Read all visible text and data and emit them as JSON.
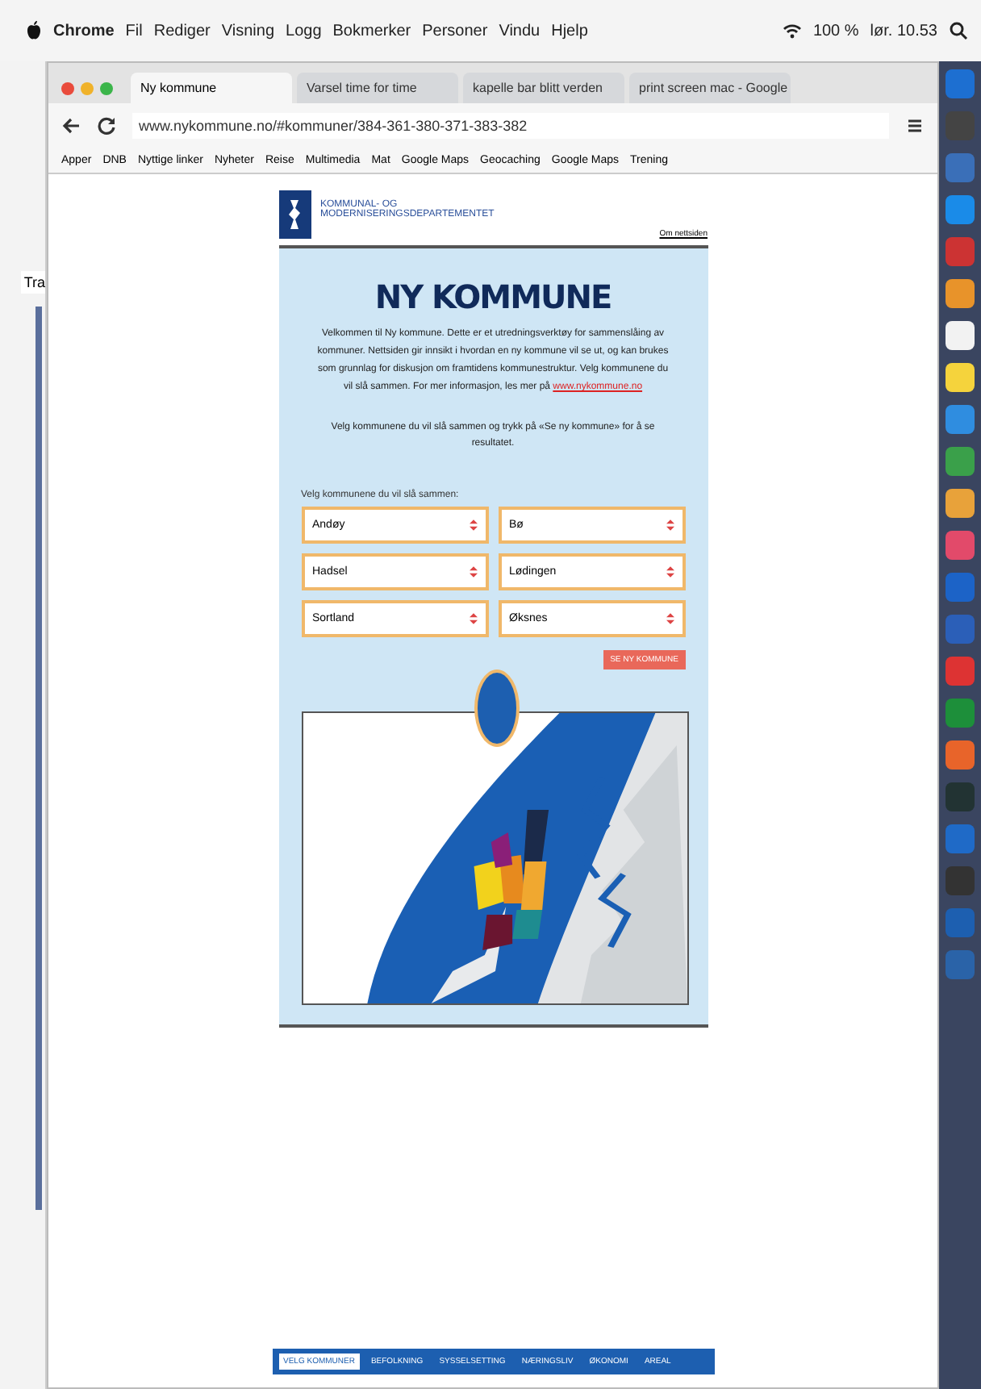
{
  "menubar": {
    "app": "Chrome",
    "items": [
      "Fil",
      "Rediger",
      "Visning",
      "Logg",
      "Bokmerker",
      "Personer",
      "Vindu",
      "Hjelp"
    ],
    "battery": "100 %",
    "clock": "lør. 10.53"
  },
  "background_window": {
    "text": "Tra"
  },
  "tabs": [
    {
      "label": "Ny kommune",
      "selected": true
    },
    {
      "label": "Varsel time for time",
      "selected": false
    },
    {
      "label": "kapelle bar blitt verden",
      "selected": false
    },
    {
      "label": "print screen mac - Google",
      "selected": false
    }
  ],
  "address": "www.nykommune.no/#kommuner/384-361-380-371-383-382",
  "bookmarks": [
    "Apper",
    "DNB",
    "Nyttige linker",
    "Nyheter",
    "Reise",
    "Multimedia",
    "Mat",
    "Google Maps",
    "Geocaching",
    "Google Maps",
    "Trening"
  ],
  "page": {
    "ministry": [
      "KOMMUNAL- OG",
      "MODERNISERINGSDEPARTEMENTET"
    ],
    "top_link": "Om nettsiden",
    "title": "NY KOMMUNE",
    "intro": "Velkommen til Ny kommune. Dette er et utredningsverktøy for sammenslåing av kommuner. Nettsiden gir innsikt i hvordan en ny kommune vil se ut, og kan brukes som grunnlag for diskusjon om framtidens kommunestruktur. Velg kommunene du vil slå sammen. For mer informasjon, les mer på",
    "intro_link": "www.nykommune.no",
    "hint": "Velg kommunene du vil slå sammen og trykk på «Se ny kommune» for å se resultatet.",
    "select_label": "Velg kommunene du vil slå sammen:",
    "selects": [
      "Andøy",
      "Bø",
      "Hadsel",
      "Lødingen",
      "Sortland",
      "Øksnes"
    ],
    "result_button": "SE NY KOMMUNE",
    "nav": [
      {
        "label": "VELG KOMMUNER",
        "selected": true
      },
      {
        "label": "BEFOLKNING",
        "selected": false
      },
      {
        "label": "SYSSELSETTING",
        "selected": false
      },
      {
        "label": "NÆRINGSLIV",
        "selected": false
      },
      {
        "label": "ØKONOMI",
        "selected": false
      },
      {
        "label": "AREAL",
        "selected": false
      }
    ]
  }
}
